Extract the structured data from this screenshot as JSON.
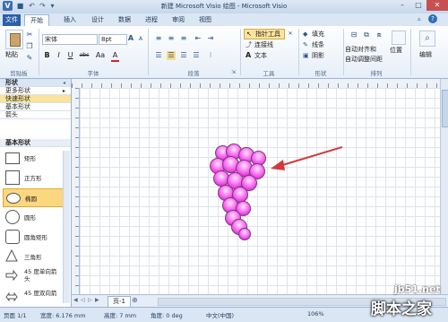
{
  "titlebar": {
    "title": "新建 Microsoft Visio 绘图 - Microsoft Visio",
    "help": "?"
  },
  "tabs": [
    "文件",
    "开始",
    "插入",
    "设计",
    "数据",
    "进程",
    "审阅",
    "视图"
  ],
  "ribbon": {
    "clipboard": {
      "paste": "粘贴",
      "label": "剪贴板"
    },
    "font": {
      "name": "宋体",
      "size": "8pt",
      "grow": "A",
      "shrink": "A",
      "bold": "B",
      "italic": "I",
      "underline": "U",
      "strike": "abc",
      "case": "Aa",
      "color": "A",
      "label": "字体"
    },
    "paragraph": {
      "label": "段落"
    },
    "tools": {
      "pointer": "指针工具",
      "connector": "连接线",
      "text": "文本",
      "text_icon": "A",
      "label": "工具"
    },
    "shape": {
      "fill": "填充",
      "line": "线条",
      "shadow": "阴影",
      "label": "形状"
    },
    "arrange": {
      "autoalign": "自动对齐和",
      "autospace": "自动调整间距",
      "position": "位置",
      "label": "排列"
    },
    "editing": {
      "label": "编辑"
    }
  },
  "pane": {
    "title": "形状",
    "nav": [
      "更多形状",
      "快速形状",
      "基本形状",
      "箭头"
    ],
    "section": "基本形状",
    "shapes": [
      "矩形",
      "正方形",
      "椭圆",
      "圆形",
      "圆角矩形",
      "三角形",
      "45 度单向箭头",
      "45 度双向箭"
    ],
    "selected_index": 2
  },
  "canvas": {
    "page_tab": "页-1",
    "nav_first": "◀",
    "nav_prev": "◁",
    "nav_next": "▷",
    "nav_last": "▶"
  },
  "status": {
    "page": "页面 1/1",
    "width": "宽度: 6.176 mm",
    "height": "高度: 7 mm",
    "angle": "角度: 0 deg",
    "lang": "中文(中国)",
    "zoom": "106%"
  },
  "watermark": {
    "site": "jb51.net",
    "name": "脚本之家"
  },
  "colors": {
    "accent": "#2a5faa",
    "grape": "#e43be0",
    "arrow": "#d23a3a"
  }
}
